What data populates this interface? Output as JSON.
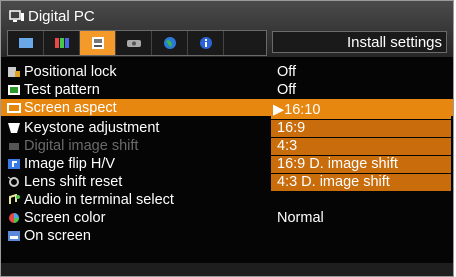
{
  "title": "Digital PC",
  "section_label": "Install settings",
  "menu": [
    {
      "label": "Positional lock",
      "value": "Off",
      "icon": "lock-icon"
    },
    {
      "label": "Test pattern",
      "value": "Off",
      "icon": "test-pattern-icon"
    },
    {
      "label": "Screen aspect",
      "value": "",
      "icon": "screen-aspect-icon"
    },
    {
      "label": "Keystone adjustment",
      "value": "",
      "icon": "keystone-icon"
    },
    {
      "label": "Digital image shift",
      "value": "",
      "icon": "image-shift-icon"
    },
    {
      "label": "Image flip H/V",
      "value": "",
      "icon": "image-flip-icon"
    },
    {
      "label": "Lens shift reset",
      "value": "",
      "icon": "lens-shift-icon"
    },
    {
      "label": "Audio in terminal select",
      "value": "",
      "icon": "audio-icon"
    },
    {
      "label": "Screen color",
      "value": "Normal",
      "icon": "screen-color-icon"
    },
    {
      "label": "On screen",
      "value": "",
      "icon": "on-screen-icon"
    }
  ],
  "dropdown_options": [
    {
      "label": "▶16:10"
    },
    {
      "label": "16:9"
    },
    {
      "label": "4:3"
    },
    {
      "label": "16:9 D. image shift"
    },
    {
      "label": "4:3 D. image shift"
    }
  ],
  "colors": {
    "selection": "#e8870f",
    "option": "#c86c0c",
    "background": "#050505"
  }
}
